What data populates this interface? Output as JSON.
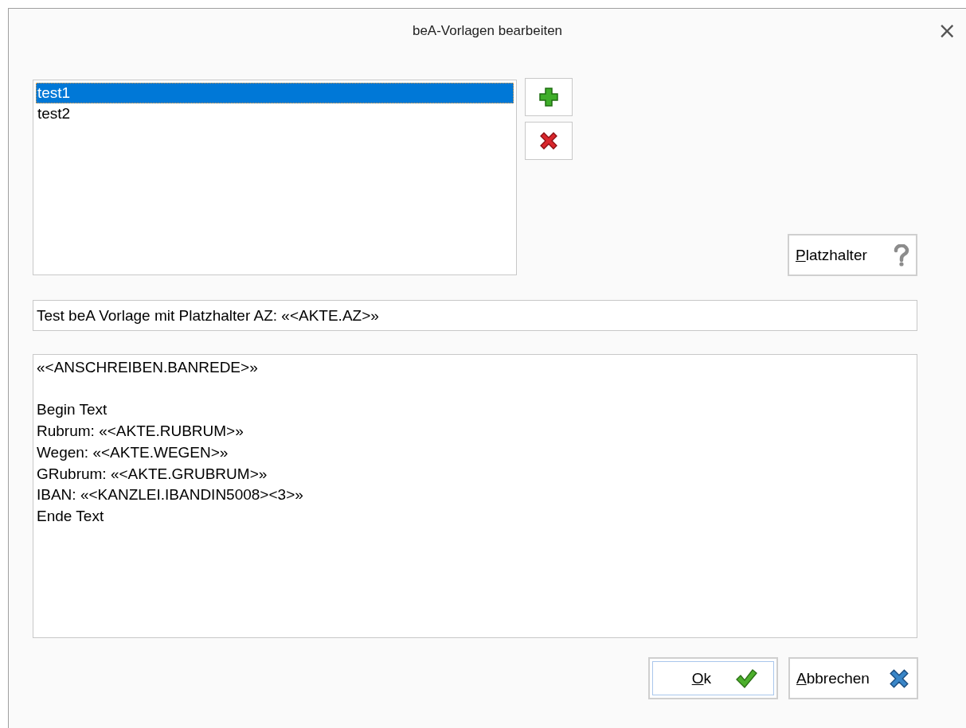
{
  "window": {
    "title": "beA-Vorlagen bearbeiten",
    "close": "×"
  },
  "templates": [
    {
      "label": "test1",
      "selected": true
    },
    {
      "label": "test2",
      "selected": false
    }
  ],
  "placeholder_button": {
    "label": "Platzhalter"
  },
  "subject": {
    "value": "Test beA Vorlage mit Platzhalter AZ: «<AKTE.AZ>»"
  },
  "body": {
    "value": "«<ANSCHREIBEN.BANREDE>»\n\nBegin Text\nRubrum: «<AKTE.RUBRUM>»\nWegen: «<AKTE.WEGEN>»\nGRubrum: «<AKTE.GRUBRUM>»\nIBAN: «<KANZLEI.IBANDIN5008><3>»\nEnde Text"
  },
  "buttons": [
    {
      "kind": "ok",
      "label": "Ok",
      "default": true
    },
    {
      "kind": "cancel",
      "label": "Abbrechen",
      "default": false
    }
  ]
}
